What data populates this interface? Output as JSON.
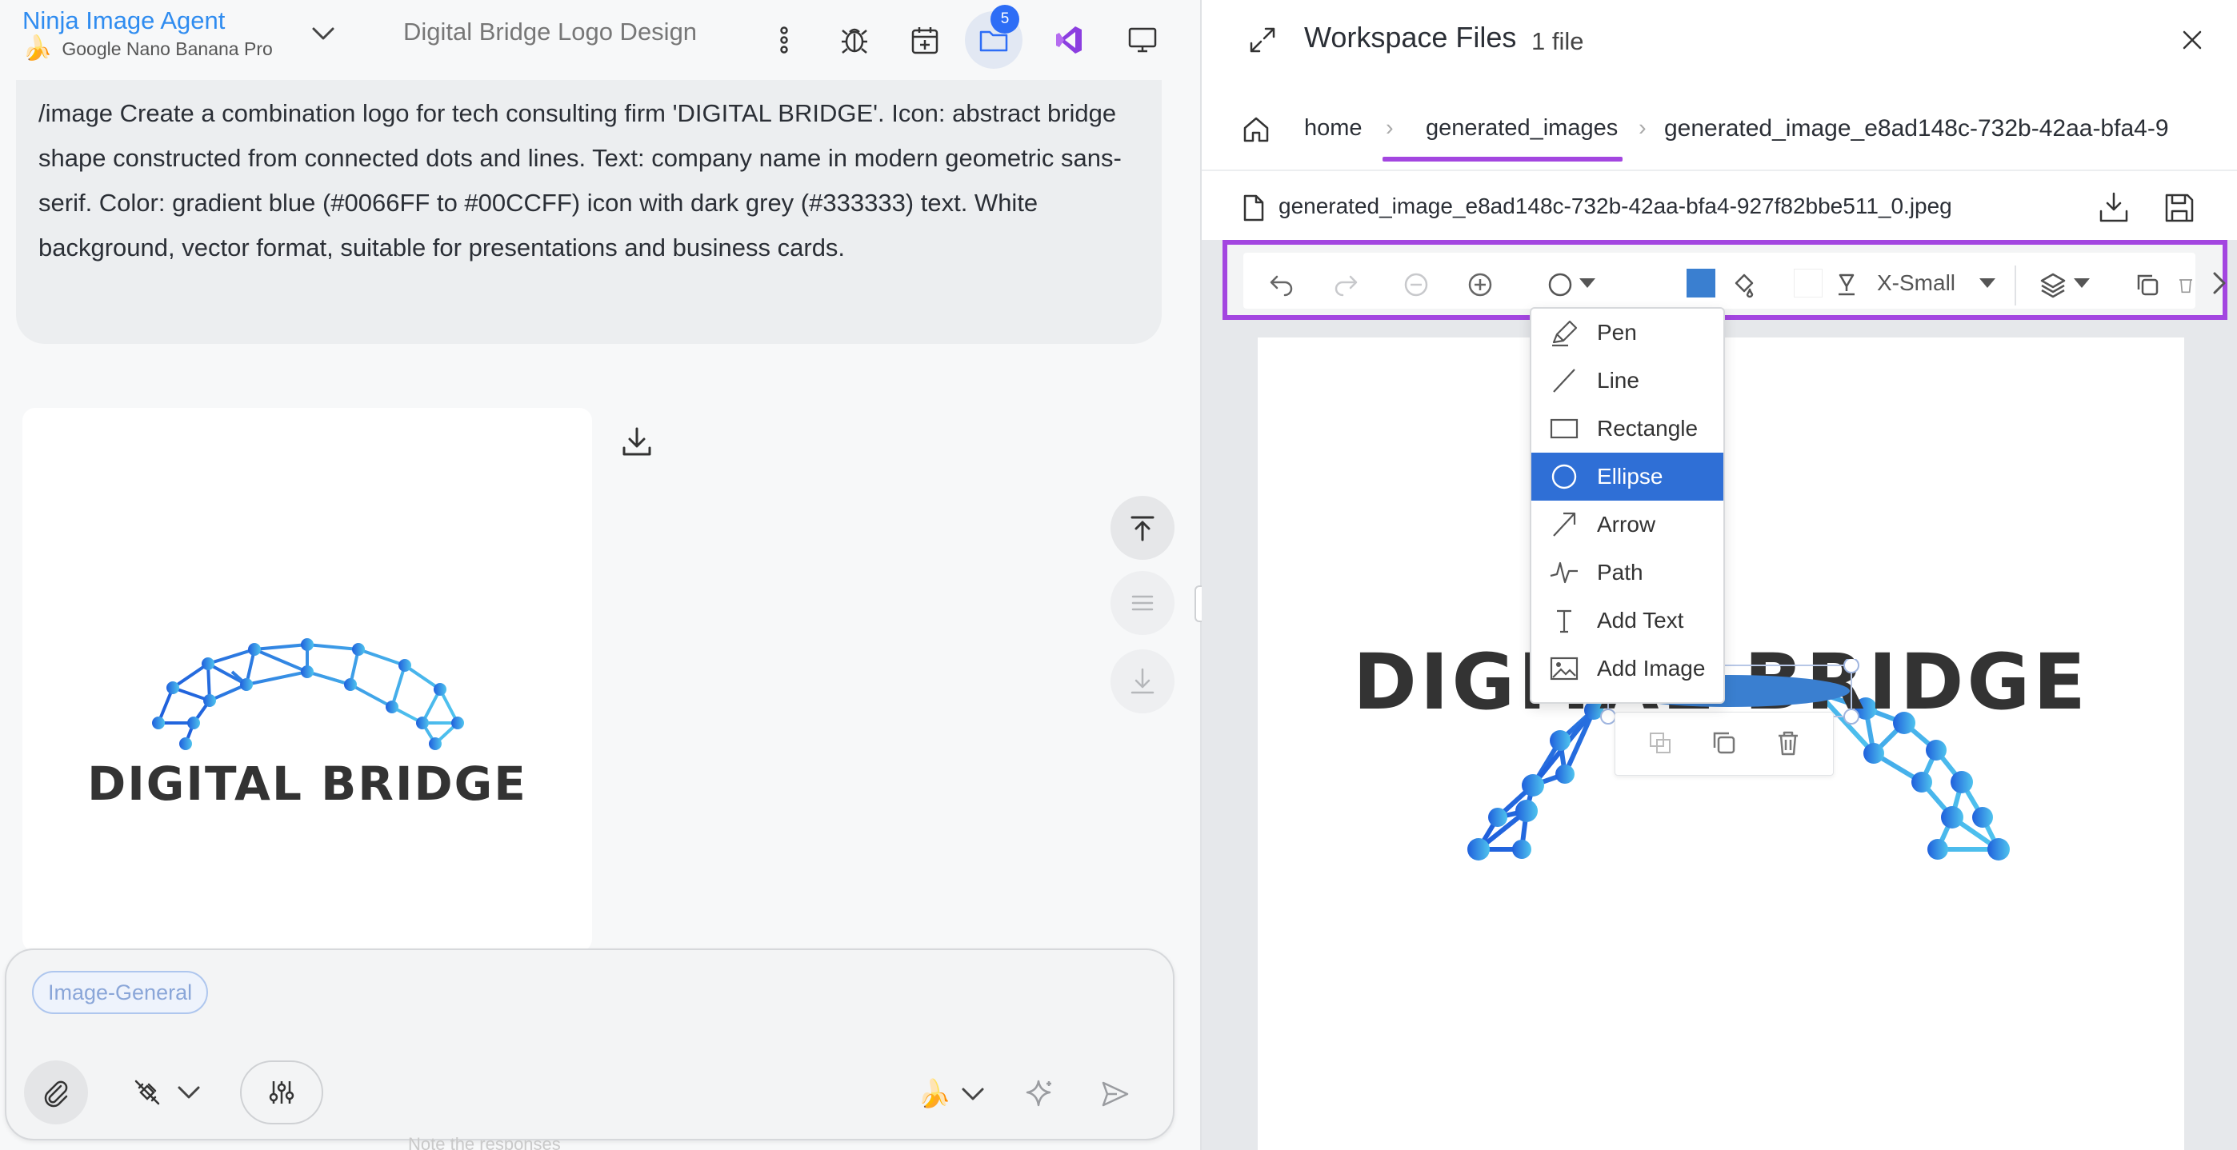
{
  "agent": {
    "name": "Ninja Image Agent",
    "model": "Google Nano Banana Pro",
    "model_icon": "🍌",
    "conversation_title": "Digital Bridge Logo Design",
    "folder_badge": "5"
  },
  "prompt": {
    "text": "/image Create a combination logo for tech consulting firm 'DIGITAL BRIDGE'. Icon: abstract bridge shape constructed from connected dots and lines. Text: company name in modern geometric sans-serif. Color: gradient blue (#0066FF to #00CCFF) icon with dark grey (#333333) text. White background, vector format, suitable for presentations and business cards."
  },
  "generated_logo": {
    "wordmark": "DIGITAL BRIDGE",
    "gradient_start": "#0066FF",
    "gradient_end": "#00CCFF",
    "text_color": "#333333"
  },
  "composer": {
    "chip": "Image-General",
    "model_icon": "🍌",
    "hint": "Note the responses"
  },
  "workspace": {
    "title": "Workspace Files",
    "count": "1 file",
    "breadcrumbs": [
      "home",
      "generated_images",
      "generated_image_e8ad148c-732b-42aa-bfa4-9"
    ],
    "file_name": "generated_image_e8ad148c-732b-42aa-bfa4-927f82bbe511_0.jpeg"
  },
  "editor_toolbar": {
    "font_size": "X-Small",
    "fill_color": "#3A7FD0",
    "stroke_color": "#FFFFFF",
    "highlight_color": "#A346E0"
  },
  "shape_menu": {
    "items": [
      {
        "label": "Pen",
        "icon": "pen-icon"
      },
      {
        "label": "Line",
        "icon": "line-icon"
      },
      {
        "label": "Rectangle",
        "icon": "rectangle-icon"
      },
      {
        "label": "Ellipse",
        "icon": "ellipse-icon",
        "selected": true
      },
      {
        "label": "Arrow",
        "icon": "arrow-icon"
      },
      {
        "label": "Path",
        "icon": "path-icon"
      },
      {
        "label": "Add Text",
        "icon": "text-icon"
      },
      {
        "label": "Add Image",
        "icon": "image-icon"
      }
    ]
  }
}
